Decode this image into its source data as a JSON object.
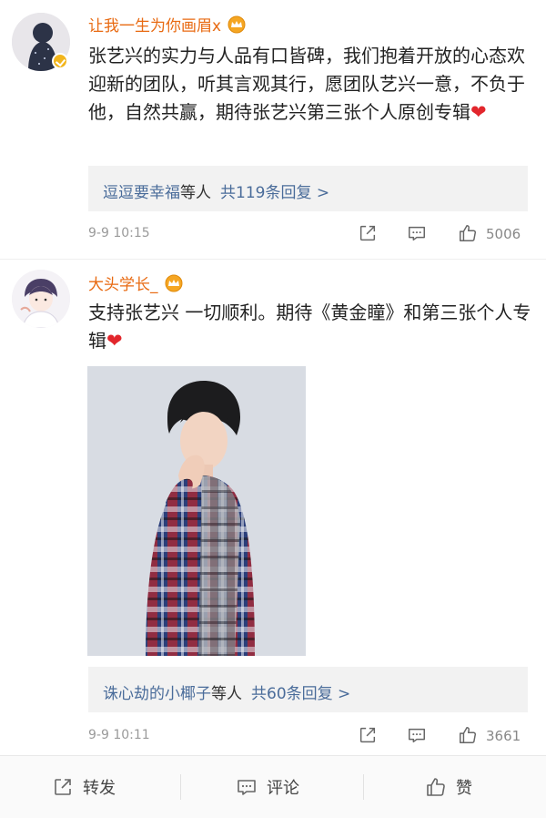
{
  "comments": [
    {
      "username": "让我一生为你画眉x",
      "text": "张艺兴的实力与人品有口皆碑，我们抱着开放的心态欢迎新的团队，听其言观其行，愿团队艺兴一意，不负于他，自然共赢，期待张艺兴第三张个人原创专辑",
      "heart": "❤",
      "replies_users": "逗逗要幸福",
      "replies_mid": "等人",
      "replies_count": "共119条回复 >",
      "time": "9-9 10:15",
      "likes": "5006",
      "verified": true
    },
    {
      "username": "大头学长_",
      "text": "支持张艺兴 一切顺利。期待《黄金瞳》和第三张个人专辑",
      "heart": "❤",
      "replies_users": "诛心劫的小椰子",
      "replies_mid": "等人",
      "replies_count": "共60条回复 >",
      "time": "9-9 10:11",
      "likes": "3661",
      "verified": false
    }
  ],
  "bottombar": {
    "share_label": "转发",
    "comment_label": "评论",
    "like_label": "赞"
  },
  "colors": {
    "username": "#e86a12",
    "link": "#4a6c9a",
    "heart": "#e2262c"
  }
}
